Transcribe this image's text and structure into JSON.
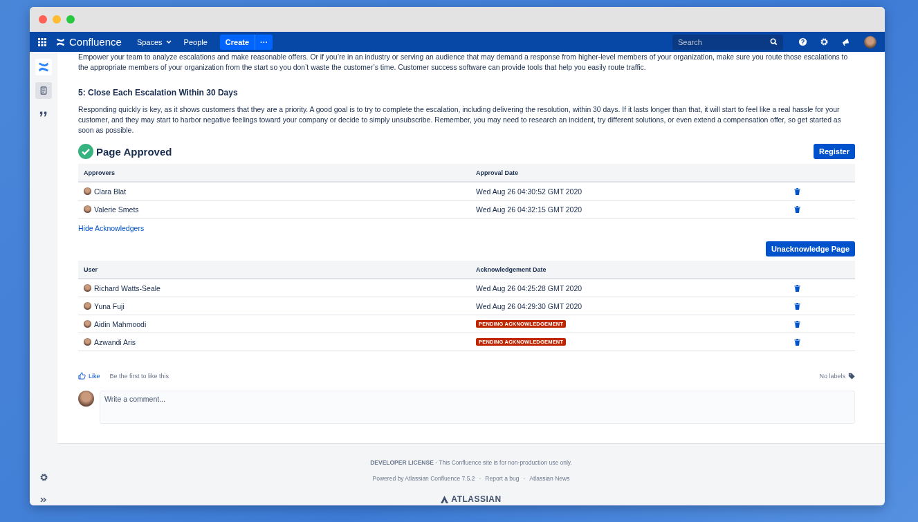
{
  "nav": {
    "product": "Confluence",
    "items": [
      {
        "label": "Spaces",
        "dropdown": true
      },
      {
        "label": "People",
        "dropdown": false
      }
    ],
    "create": "Create",
    "more": "···",
    "search": {
      "placeholder": "Search"
    }
  },
  "article": {
    "paragraphs_top": [
      "Empower your team to analyze escalations and make reasonable offers. Or if you’re in an industry or serving an audience that may demand a response from higher-level members of your organization, make sure you route those escalations to the appropriate members of your organization from the start so you don’t waste the customer’s time. Customer success software can provide tools that help you easily route traffic."
    ],
    "heading": "5: Close Each Escalation Within 30 Days",
    "paragraph": "Responding quickly is key, as it shows customers that they are a priority. A good goal is to try to complete the escalation, including delivering the resolution, within 30 days. If it lasts longer than that, it will start to feel like a real hassle for your customer, and they may start to harbor negative feelings toward your company or decide to simply unsubscribe. Remember, you may need to research an incident, try different solutions, or even extend a compensation offer, so get started as soon as possible."
  },
  "approval": {
    "status": "Page Approved",
    "approved": true,
    "button": "Register",
    "columns": [
      "Approvers",
      "Approval Date"
    ],
    "rows": [
      {
        "name": "Clara Blat",
        "kind": "date",
        "date": "Wed Aug 26 04:30:52 GMT 2020"
      },
      {
        "name": "Valerie Smets",
        "kind": "date",
        "date": "Wed Aug 26 04:32:15 GMT 2020"
      }
    ]
  },
  "toggle_link": "Hide Acknowledgers",
  "acknowledgement": {
    "button": "Unacknowledge Page",
    "columns": [
      "User",
      "Acknowledgement Date"
    ],
    "rows": [
      {
        "name": "Richard Watts-Seale",
        "kind": "date",
        "date": "Wed Aug 26 04:25:28 GMT 2020"
      },
      {
        "name": "Yuna Fuji",
        "kind": "date",
        "date": "Wed Aug 26 04:29:30 GMT 2020"
      },
      {
        "name": "Aidin Mahmoodi",
        "kind": "pending",
        "date": "PENDING ACKNOWLEDGEMENT"
      },
      {
        "name": "Azwandi Aris",
        "kind": "pending",
        "date": "PENDING ACKNOWLEDGEMENT"
      }
    ]
  },
  "likes": {
    "like": "Like",
    "text": "Be the first to like this",
    "labels": "No labels"
  },
  "comment": {
    "placeholder": "Write a comment..."
  },
  "footer": {
    "license_bold": "DEVELOPER LICENSE",
    "license_text": "- This Confluence site is for non-production use only.",
    "links": [
      "Powered by Atlassian Confluence 7.5.2",
      "Report a bug",
      "Atlassian News"
    ],
    "separator": "·",
    "brand": "ATLASSIAN"
  }
}
